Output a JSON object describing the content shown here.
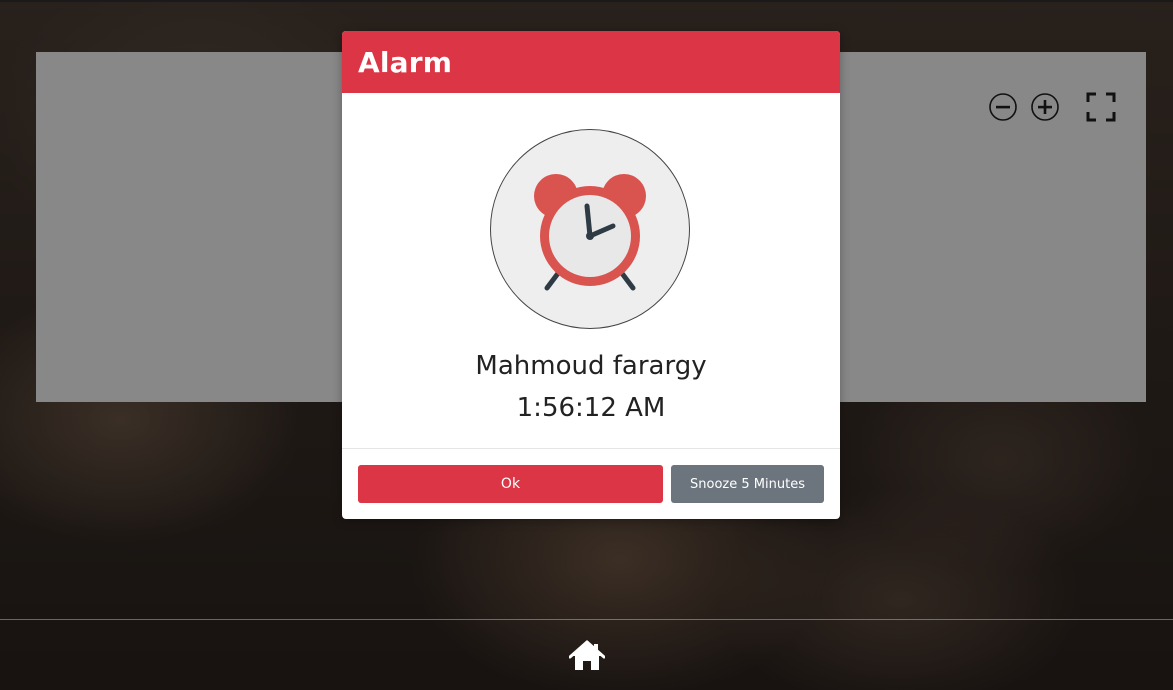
{
  "modal": {
    "title": "Alarm",
    "name": "Mahmoud farargy",
    "time": "1:56:12 AM",
    "ok_label": "Ok",
    "snooze_label": "Snooze 5 Minutes"
  },
  "viewer": {
    "controls": [
      "zoom-out-icon",
      "zoom-in-icon",
      "fullscreen-icon"
    ]
  },
  "bottom_bar": {
    "icon": "home-icon"
  },
  "colors": {
    "accent": "#dc3545",
    "secondary": "#6c757d",
    "panel": "#888888",
    "clock_body": "#d9534f"
  }
}
